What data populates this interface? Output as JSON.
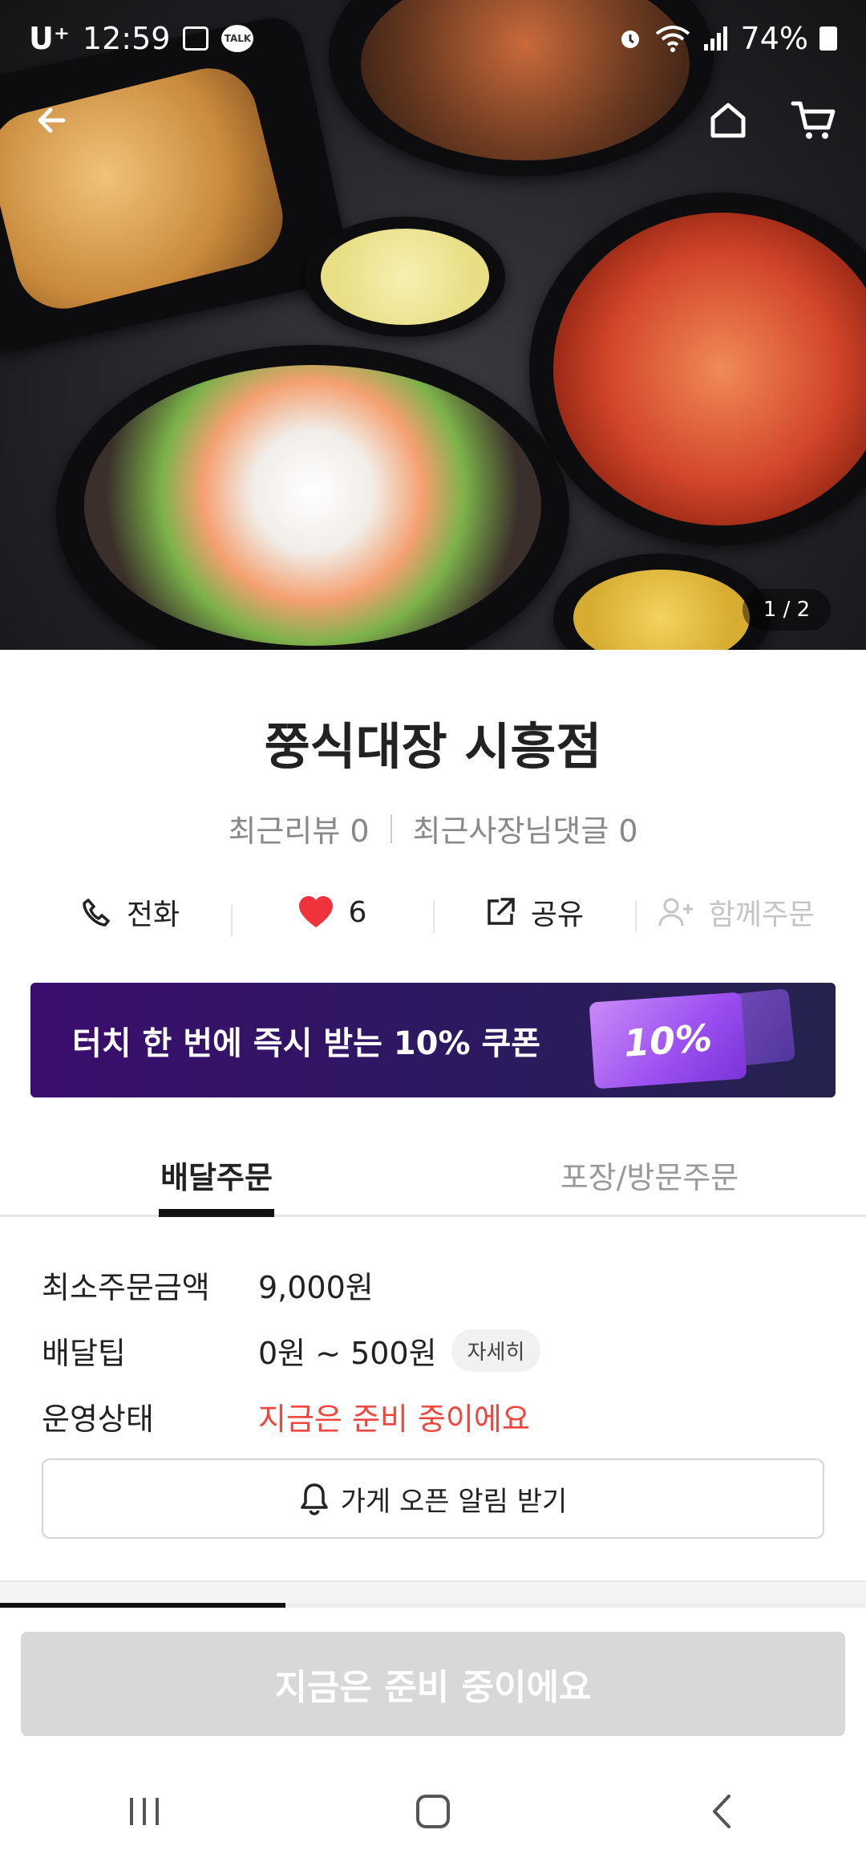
{
  "status_bar": {
    "carrier": "U⁺",
    "time": "12:59",
    "talk_badge": "TALK",
    "battery": "74%"
  },
  "hero": {
    "page_indicator": "1 / 2",
    "icons": {
      "back": "arrow-left-icon",
      "home": "home-icon",
      "cart": "cart-icon"
    }
  },
  "store": {
    "name": "쭝식대장 시흥점",
    "recent_reviews": "최근리뷰 0",
    "recent_owner_replies": "최근사장님댓글 0"
  },
  "actions": [
    {
      "label": "전화",
      "icon": "phone-icon"
    },
    {
      "label": "6",
      "icon": "heart-icon"
    },
    {
      "label": "공유",
      "icon": "share-icon"
    },
    {
      "label": "함께주문",
      "icon": "add-user-icon"
    }
  ],
  "banner": {
    "text": "터치 한 번에 즉시 받는 10% 쿠폰",
    "ticket_text": "10%"
  },
  "tabs": [
    {
      "label": "배달주문"
    },
    {
      "label": "포장/방문주문"
    }
  ],
  "info": {
    "min_order": {
      "label": "최소주문금액",
      "value": "9,000원"
    },
    "delivery_tip": {
      "label": "배달팁",
      "value": "0원 ~ 500원",
      "detail": "자세히"
    },
    "status": {
      "label": "운영상태",
      "value": "지금은 준비 중이에요"
    }
  },
  "notify_button": "가게 오픈 알림 받기",
  "cta_button": "지금은 준비 중이에요",
  "colors": {
    "accent_red": "#f2453d",
    "heart": "#f0323b",
    "banner_bg": "#3a0e6e",
    "ticket": "#a85cf0",
    "cta_disabled": "#d8d8d8"
  }
}
